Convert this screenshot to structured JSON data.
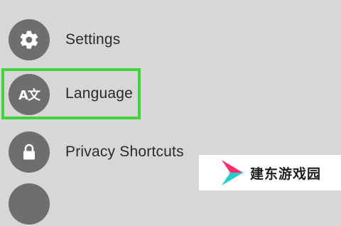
{
  "menu": {
    "items": [
      {
        "label": "Settings",
        "icon": "gear-icon"
      },
      {
        "label": "Language",
        "icon": "translate-icon",
        "icon_text": "A文",
        "highlighted": true
      },
      {
        "label": "Privacy Shortcuts",
        "icon": "lock-icon"
      }
    ]
  },
  "colors": {
    "background": "#d7d7d7",
    "icon_circle": "#6e6e6e",
    "highlight": "#3fd43a",
    "text": "#2a2a2a"
  },
  "watermark": {
    "text": "建东游戏园",
    "logo_colors": [
      "#ff2d6a",
      "#1fd1c8"
    ]
  }
}
